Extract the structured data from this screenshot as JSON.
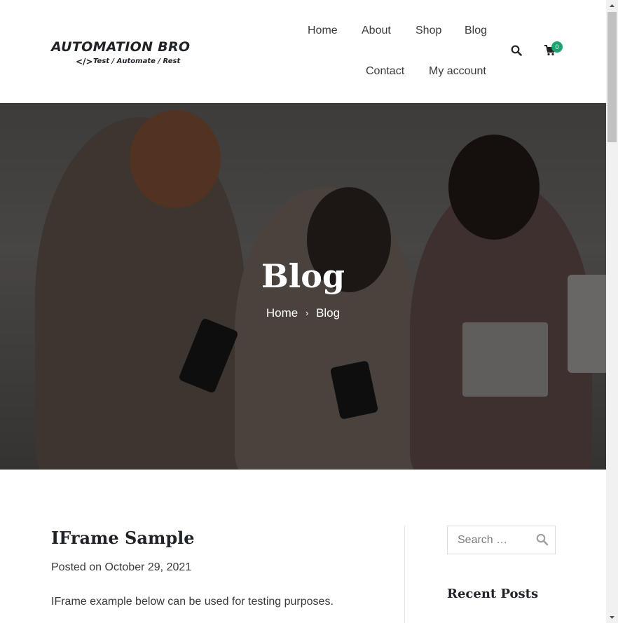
{
  "header": {
    "logo_title": "AUTOMATION BRO",
    "logo_code": "</>",
    "logo_tagline": "Test / Automate / Rest",
    "nav": [
      {
        "label": "Home"
      },
      {
        "label": "About"
      },
      {
        "label": "Shop"
      },
      {
        "label": "Blog"
      },
      {
        "label": "Contact"
      },
      {
        "label": "My account"
      }
    ],
    "search_icon": "search-icon",
    "cart_icon": "cart-icon",
    "cart_count": "0",
    "accent_color": "#1aa36f"
  },
  "hero": {
    "title": "Blog",
    "breadcrumb": [
      "Home",
      "Blog"
    ],
    "breadcrumb_separator": "›"
  },
  "post": {
    "title": "IFrame Sample",
    "meta_prefix": "Posted on",
    "date": "October 29, 2021",
    "excerpt": "IFrame example below can be used for testing purposes."
  },
  "sidebar": {
    "search_placeholder": "Search …",
    "widget_title": "Recent Posts"
  }
}
